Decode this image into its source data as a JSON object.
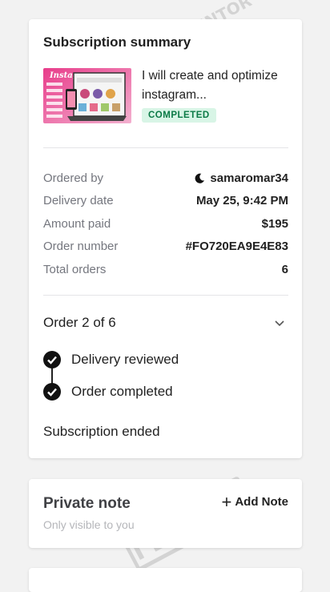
{
  "summary": {
    "title": "Subscription summary",
    "gig_title": "I will create and optimize instagram...",
    "status": "COMPLETED",
    "thumbnail_text": "Instagram",
    "details": [
      {
        "label": "Ordered by",
        "value": "samaromar34",
        "icon": "moon-icon"
      },
      {
        "label": "Delivery date",
        "value": "May 25, 9:42 PM"
      },
      {
        "label": "Amount paid",
        "value": "$195"
      },
      {
        "label": "Order number",
        "value": "#FO720EA9E4E83"
      },
      {
        "label": "Total orders",
        "value": "6"
      }
    ],
    "order_progress": "Order 2 of 6",
    "steps": [
      {
        "label": "Delivery reviewed"
      },
      {
        "label": "Order completed"
      }
    ],
    "subscription_status": "Subscription ended"
  },
  "private_note": {
    "title": "Private note",
    "subtitle": "Only visible to you",
    "add_label": "Add Note"
  },
  "watermark": {
    "line1": "MENTOR",
    "line2": "GENIX"
  },
  "colors": {
    "badge_bg": "#d8f5e6",
    "badge_text": "#0b7a46",
    "muted": "#74767e"
  }
}
